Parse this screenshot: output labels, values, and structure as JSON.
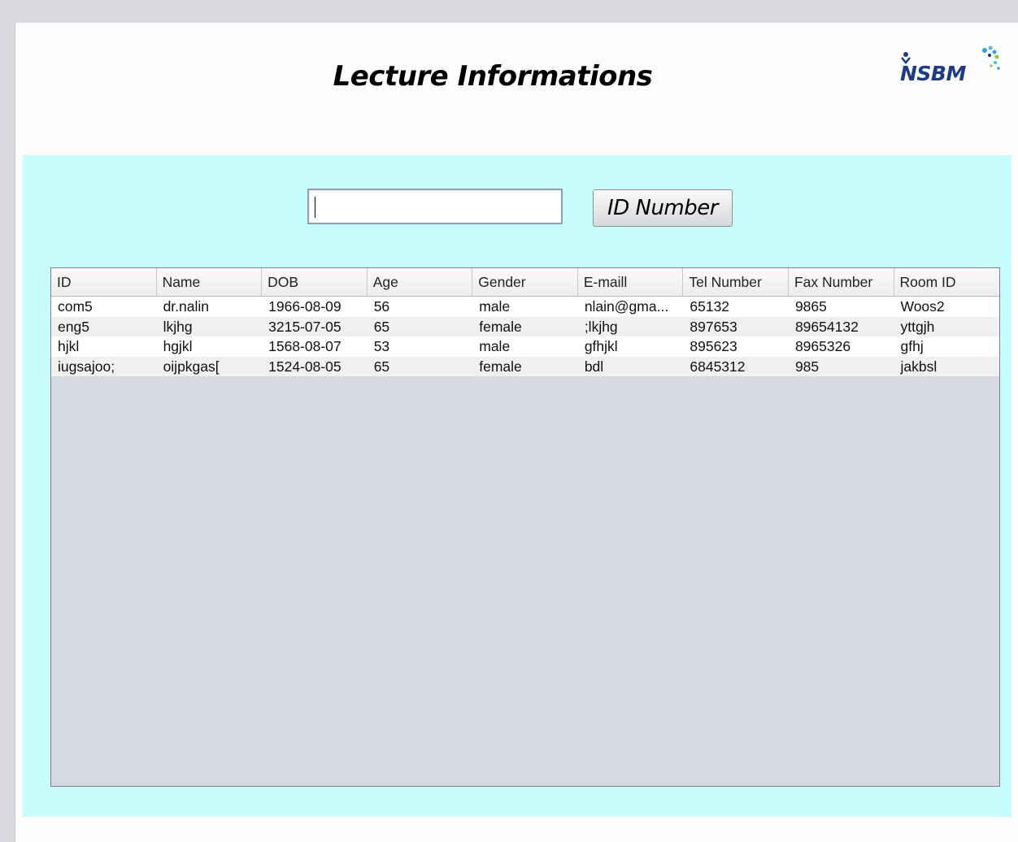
{
  "header": {
    "title": "Lecture Informations",
    "logo_text": "NSBM"
  },
  "search": {
    "value": "",
    "button_label": "ID Number"
  },
  "table": {
    "columns": [
      "ID",
      "Name",
      "DOB",
      "Age",
      "Gender",
      "E-maill",
      "Tel Number",
      "Fax Number",
      "Room ID"
    ],
    "rows": [
      [
        "com5",
        "dr.nalin",
        "1966-08-09",
        "56",
        "male",
        "nlain@gma...",
        "65132",
        "9865",
        "Woos2"
      ],
      [
        "eng5",
        "lkjhg",
        "3215-07-05",
        "65",
        "female",
        ";lkjhg",
        "897653",
        "89654132",
        "yttgjh"
      ],
      [
        "hjkl",
        "hgjkl",
        "1568-08-07",
        "53",
        "male",
        "gfhjkl",
        "895623",
        "8965326",
        "gfhj"
      ],
      [
        "iugsajoo;",
        "oijpkgas[",
        "1524-08-05",
        "65",
        "female",
        "bdl",
        "6845312",
        "985",
        "jakbsl"
      ]
    ]
  },
  "colors": {
    "panel_background": "#c6fdfc",
    "table_background": "#d6d9df",
    "logo_text": "#1f3b84",
    "logo_accent": "#2fa3dc"
  }
}
